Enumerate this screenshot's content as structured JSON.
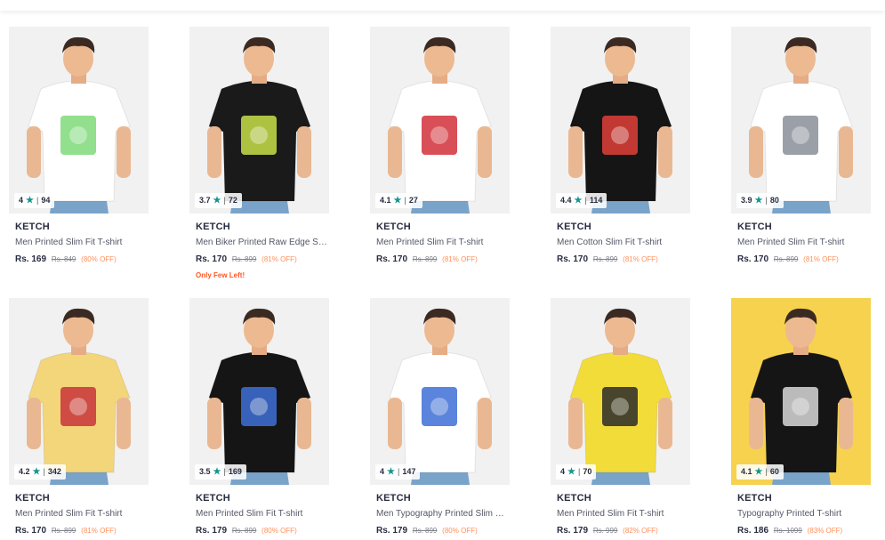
{
  "products": [
    {
      "brand": "KETCH",
      "title": "Men Printed Slim Fit T-shirt",
      "price": "Rs. 169",
      "mrp": "Rs. 849",
      "discount": "(80% OFF)",
      "rating": "4",
      "count": "94",
      "shirt": "#ffffff",
      "bg": "#f1f1f1",
      "note": "",
      "print": "#7fd97a"
    },
    {
      "brand": "KETCH",
      "title": "Men Biker Printed Raw Edge Slim Fit T-shirt",
      "price": "Rs. 170",
      "mrp": "Rs. 899",
      "discount": "(81% OFF)",
      "rating": "3.7",
      "count": "72",
      "shirt": "#1a1a1a",
      "bg": "#f1f1f1",
      "note": "Only Few Left!",
      "print": "#c9e04a"
    },
    {
      "brand": "KETCH",
      "title": "Men Printed Slim Fit T-shirt",
      "price": "Rs. 170",
      "mrp": "Rs. 899",
      "discount": "(81% OFF)",
      "rating": "4.1",
      "count": "27",
      "shirt": "#ffffff",
      "bg": "#f1f1f1",
      "note": "",
      "print": "#d2303a"
    },
    {
      "brand": "KETCH",
      "title": "Men Cotton Slim Fit T-shirt",
      "price": "Rs. 170",
      "mrp": "Rs. 899",
      "discount": "(81% OFF)",
      "rating": "4.4",
      "count": "114",
      "shirt": "#151515",
      "bg": "#f1f1f1",
      "note": "",
      "print": "#e0403a"
    },
    {
      "brand": "KETCH",
      "title": "Men Printed Slim Fit T-shirt",
      "price": "Rs. 170",
      "mrp": "Rs. 899",
      "discount": "(81% OFF)",
      "rating": "3.9",
      "count": "80",
      "shirt": "#ffffff",
      "bg": "#f1f1f1",
      "note": "",
      "print": "#8a8f99"
    },
    {
      "brand": "KETCH",
      "title": "Men Printed Slim Fit T-shirt",
      "price": "Rs. 170",
      "mrp": "Rs. 899",
      "discount": "(81% OFF)",
      "rating": "4.2",
      "count": "342",
      "shirt": "#f3d57a",
      "bg": "#f1f1f1",
      "note": "",
      "print": "#c7343a"
    },
    {
      "brand": "KETCH",
      "title": "Men Printed Slim Fit T-shirt",
      "price": "Rs. 179",
      "mrp": "Rs. 899",
      "discount": "(80% OFF)",
      "rating": "3.5",
      "count": "169",
      "shirt": "#151515",
      "bg": "#f1f1f1",
      "note": "",
      "print": "#3e6fd6"
    },
    {
      "brand": "KETCH",
      "title": "Men Typography Printed Slim Fit T-shirt",
      "price": "Rs. 179",
      "mrp": "Rs. 899",
      "discount": "(80% OFF)",
      "rating": "4",
      "count": "147",
      "shirt": "#ffffff",
      "bg": "#f1f1f1",
      "note": "",
      "print": "#3e6fd6"
    },
    {
      "brand": "KETCH",
      "title": "Men Printed Slim Fit T-shirt",
      "price": "Rs. 179",
      "mrp": "Rs. 999",
      "discount": "(82% OFF)",
      "rating": "4",
      "count": "70",
      "shirt": "#f2dc3a",
      "bg": "#f1f1f1",
      "note": "",
      "print": "#2a2a2a"
    },
    {
      "brand": "KETCH",
      "title": "Typography Printed T-shirt",
      "price": "Rs. 186",
      "mrp": "Rs. 1099",
      "discount": "(83% OFF)",
      "rating": "4.1",
      "count": "60",
      "shirt": "#151515",
      "bg": "#f6d24f",
      "note": "",
      "print": "#d8d8d8"
    }
  ]
}
